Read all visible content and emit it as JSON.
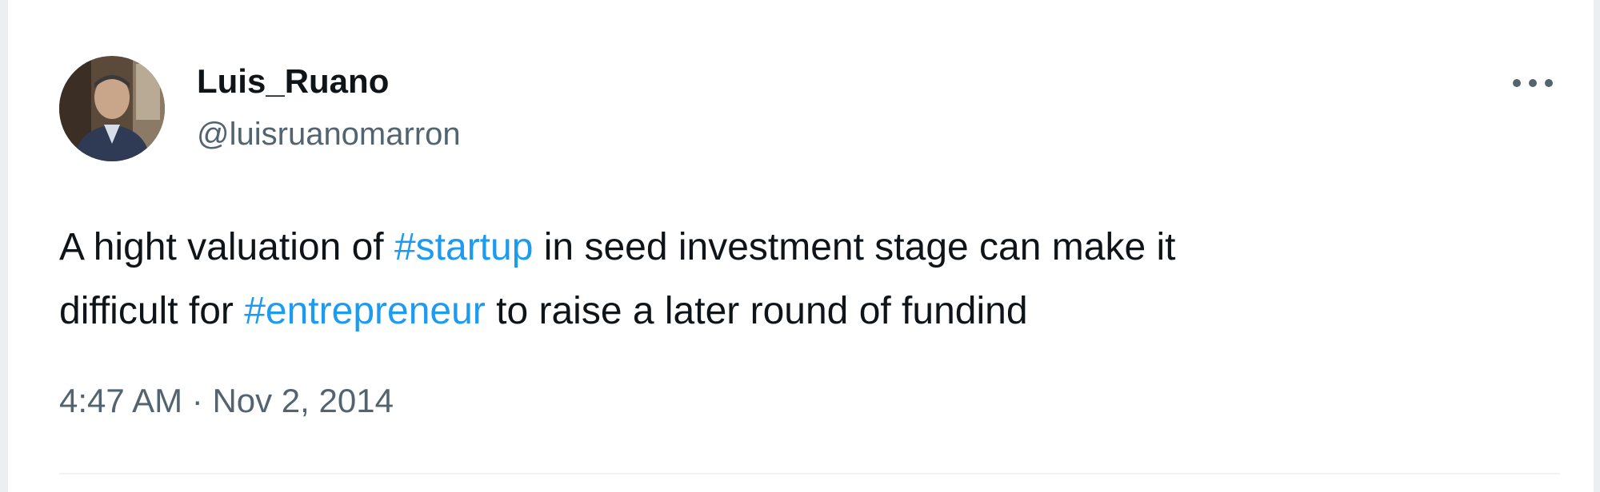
{
  "tweet": {
    "author": {
      "display_name": "Luis_Ruano",
      "handle": "@luisruanomarron"
    },
    "more_icon": "more-horizontal-icon",
    "text": {
      "line1": [
        {
          "type": "text",
          "value": "A hight valuation of "
        },
        {
          "type": "hashtag",
          "value": "#startup"
        },
        {
          "type": "text",
          "value": " in seed investment stage can make it"
        }
      ],
      "line2": [
        {
          "type": "text",
          "value": "difficult for "
        },
        {
          "type": "hashtag",
          "value": "#entrepreneur"
        },
        {
          "type": "text",
          "value": " to raise a later round of fundind"
        }
      ]
    },
    "meta": {
      "time": "4:47 AM",
      "separator": " · ",
      "date": "Nov 2, 2014"
    }
  },
  "colors": {
    "hashtag": "#1d9bf0",
    "primary_text": "#0f1419",
    "secondary_text": "#536471",
    "divider": "#eff3f4"
  }
}
